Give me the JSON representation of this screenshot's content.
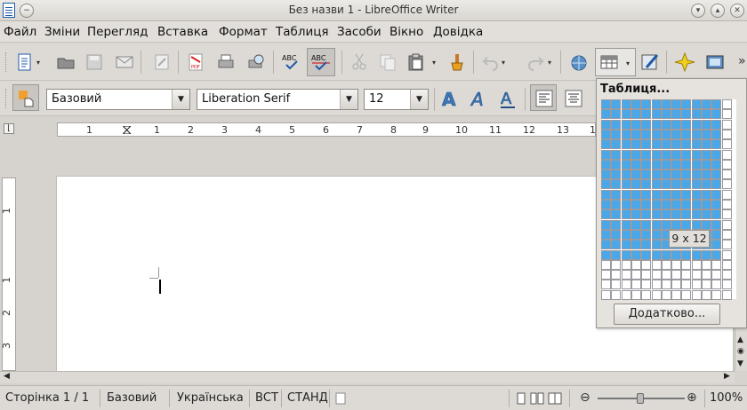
{
  "window": {
    "title": "Без назви 1 - LibreOffice Writer"
  },
  "menu": {
    "items": [
      "Файл",
      "Зміни",
      "Перегляд",
      "Вставка",
      "Формат",
      "Таблиця",
      "Засоби",
      "Вікно",
      "Довідка"
    ]
  },
  "formatting": {
    "style": "Базовий",
    "font": "Liberation Serif",
    "size": "12"
  },
  "ruler": {
    "h_labels": [
      "1",
      "1",
      "2",
      "3",
      "4",
      "5",
      "6",
      "7",
      "8",
      "9",
      "10",
      "11",
      "12",
      "13",
      "1"
    ],
    "v_labels": [
      "1",
      "1",
      "2",
      "3"
    ]
  },
  "table_popup": {
    "title": "Таблиця...",
    "size_label": "9 x 12",
    "more_button": "Додатково...",
    "selected_cols": 12,
    "selected_rows": 16,
    "total_cols": 13,
    "total_rows": 20
  },
  "status": {
    "page": "Сторінка 1 / 1",
    "style": "Базовий",
    "language": "Українська",
    "insert_mode": "ВСТ",
    "selection_mode": "СТАНД",
    "zoom": "100%"
  },
  "colors": {
    "selection": "#4aa8e8",
    "accent": "#1f5aa8"
  }
}
